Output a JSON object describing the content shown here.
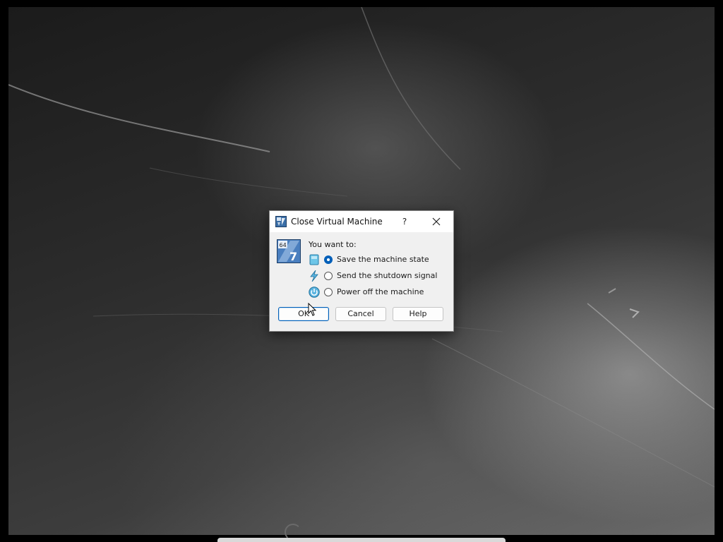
{
  "dialog": {
    "title": "Close Virtual Machine",
    "help_label": "?",
    "close_label": "✕",
    "icon": "virtualbox-os-windows7-64-icon",
    "prompt": "You want to:",
    "options": [
      {
        "label": "Save the machine state",
        "icon": "save-state-icon",
        "selected": true
      },
      {
        "label": "Send the shutdown signal",
        "icon": "acpi-shutdown-icon",
        "selected": false
      },
      {
        "label": "Power off the machine",
        "icon": "power-off-icon",
        "selected": false
      }
    ],
    "buttons": {
      "ok": "OK",
      "cancel": "Cancel",
      "help": "Help"
    },
    "big_icon_text": {
      "arch": "64",
      "version": "7"
    }
  },
  "colors": {
    "accent": "#005fb8",
    "dialog_bg": "#f0f0f0",
    "titlebar_bg": "#ffffff",
    "desktop_bg": "#2c2c2c"
  }
}
